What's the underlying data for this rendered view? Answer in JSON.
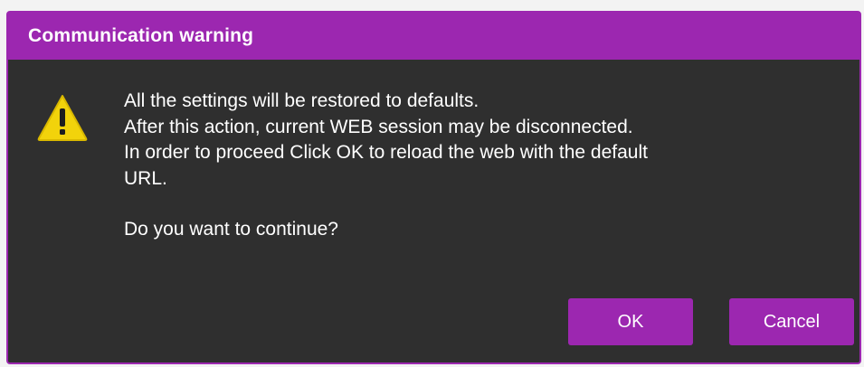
{
  "dialog": {
    "title": "Communication warning",
    "icon": "warning-triangle-icon",
    "message_lines": [
      "All the settings will be restored to defaults.",
      "After this action, current WEB session may be disconnected.",
      "In order to proceed Click OK to reload the web with the default",
      "URL."
    ],
    "question": "Do you want to continue?",
    "ok_label": "OK",
    "cancel_label": "Cancel"
  },
  "colors": {
    "accent": "#9c27b0",
    "dialog_bg": "#2f2f2f",
    "warning_yellow": "#f2d30b",
    "text": "#ffffff"
  }
}
